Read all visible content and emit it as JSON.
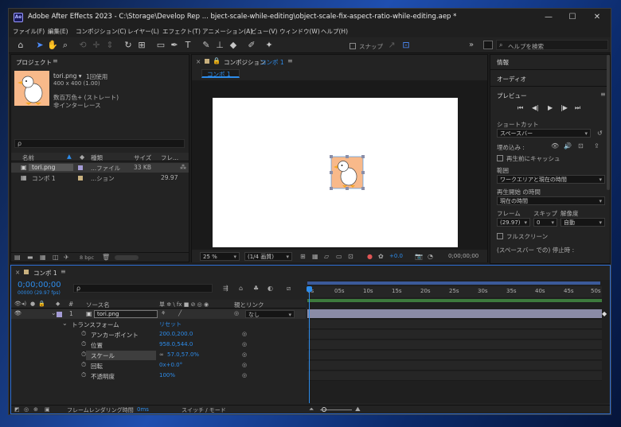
{
  "window": {
    "title": "Adobe After Effects 2023 - C:\\Storage\\Develop Rep ... bject-scale-while-editing\\object-scale-fix-aspect-ratio-while-editing.aep *",
    "app_icon": "Ae",
    "minimize": "—",
    "maximize": "☐",
    "close": "✕"
  },
  "menu": [
    "ファイル(F)",
    "編集(E)",
    "コンポジション(C)",
    "レイヤー(L)",
    "エフェクト(T)",
    "アニメーション(A)",
    "ビュー(V)",
    "ウィンドウ(W)",
    "ヘルプ(H)"
  ],
  "toolbar": {
    "snap_label": "スナップ",
    "search_placeholder": "ヘルプを検索",
    "more": "»"
  },
  "project": {
    "tab": "プロジェクト",
    "item_name": "tori.png ▾",
    "usage": "1回使用",
    "dimensions": "400 x 400 (1.00)",
    "color": "数百万色+ (ストレート)",
    "interlace": "非インターレース",
    "columns": [
      "名前",
      "種類",
      "サイズ",
      "フレ..."
    ],
    "rows": [
      {
        "name": "tori.png",
        "type": "...ファイル",
        "size": "33 KB",
        "frames": ""
      },
      {
        "name": "コンポ 1",
        "type": "...ション",
        "size": "",
        "frames": "29.97"
      }
    ],
    "bpc": "8 bpc"
  },
  "composition": {
    "tab": "コンポジション",
    "comp_name": "コンポ 1",
    "sub_tab": "コンポ 1",
    "zoom": "25 %",
    "resolution": "(1/4 画質)",
    "exposure": "+0.0",
    "timecode": "0;00;00;00"
  },
  "side": {
    "info_tab": "情報",
    "audio_tab": "オーディオ",
    "preview_tab": "プレビュー",
    "shortcut_label": "ショートカット",
    "shortcut_value": "スペースバー",
    "include_label": "埋め込み :",
    "cache_label": "再生前にキャッシュ",
    "range_label": "範囲",
    "range_value": "ワークエリアと現在の時間",
    "start_label": "再生開始 の時間",
    "start_value": "現在の時間",
    "frame_label": "フレーム",
    "skip_label": "スキップ",
    "res_label": "解像度",
    "frame_value": "(29.97)",
    "skip_value": "0",
    "res_value": "自動",
    "fullscreen_label": "フルスクリーン",
    "stop_label": "(スペースバー での) 停止時 :"
  },
  "timeline": {
    "tab": "コンポ 1",
    "timecode": "0;00;00;00",
    "fps": "00000 (29.97 fps)",
    "search_placeholder": "ρ",
    "col_source": "ソース名",
    "col_parent": "親とリンク",
    "col_switches": "単 ✲ \\ fx ■ ⊘ ◎ ◉",
    "layer": {
      "num": "1",
      "name": "tori.png",
      "parent": "なし"
    },
    "transform_label": "トランスフォーム",
    "reset_label": "リセット",
    "properties": [
      {
        "name": "アンカーポイント",
        "value": "200.0,200.0"
      },
      {
        "name": "位置",
        "value": "958.0,544.0"
      },
      {
        "name": "スケール",
        "value": "57.0,57.0%"
      },
      {
        "name": "回転",
        "value": "0x+0.0°"
      },
      {
        "name": "不透明度",
        "value": "100%"
      }
    ],
    "ruler": [
      "0s",
      "05s",
      "10s",
      "15s",
      "20s",
      "25s",
      "30s",
      "35s",
      "40s",
      "45s",
      "50s"
    ],
    "render_time_label": "フレームレンダリング時間",
    "render_time_value": "0ms",
    "switch_mode": "スイッチ / モード"
  }
}
